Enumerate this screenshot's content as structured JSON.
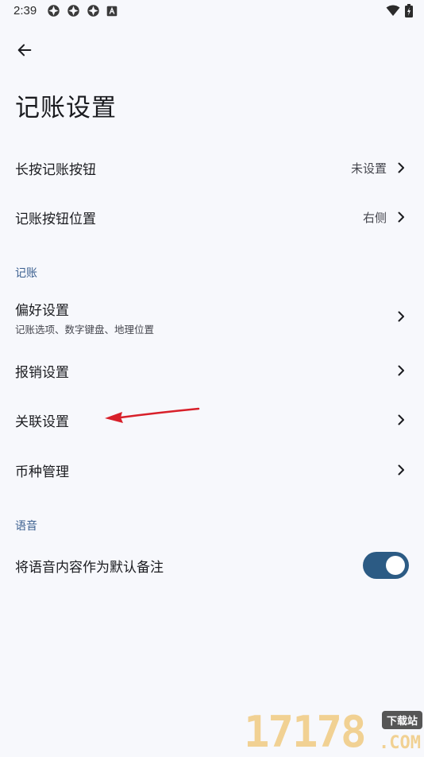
{
  "status_bar": {
    "time": "2:39"
  },
  "header": {
    "title": "记账设置"
  },
  "rows": {
    "long_press": {
      "label": "长按记账按钮",
      "value": "未设置"
    },
    "button_position": {
      "label": "记账按钮位置",
      "value": "右侧"
    }
  },
  "sections": {
    "bookkeeping": {
      "header": "记账",
      "preferences": {
        "label": "偏好设置",
        "subtitle": "记账选项、数字键盘、地理位置"
      },
      "reimbursement": {
        "label": "报销设置"
      },
      "association": {
        "label": "关联设置"
      },
      "currency": {
        "label": "币种管理"
      }
    },
    "voice": {
      "header": "语音",
      "voice_note": {
        "label": "将语音内容作为默认备注",
        "toggle_on": true
      }
    }
  },
  "watermark": {
    "digits": "17178",
    "badge": "下载站",
    "suffix": ".COM"
  },
  "colors": {
    "background": "#f7f8fc",
    "section_header": "#3b5f8f",
    "toggle_on": "#2c5b84",
    "annotation_arrow": "#d8202a"
  }
}
